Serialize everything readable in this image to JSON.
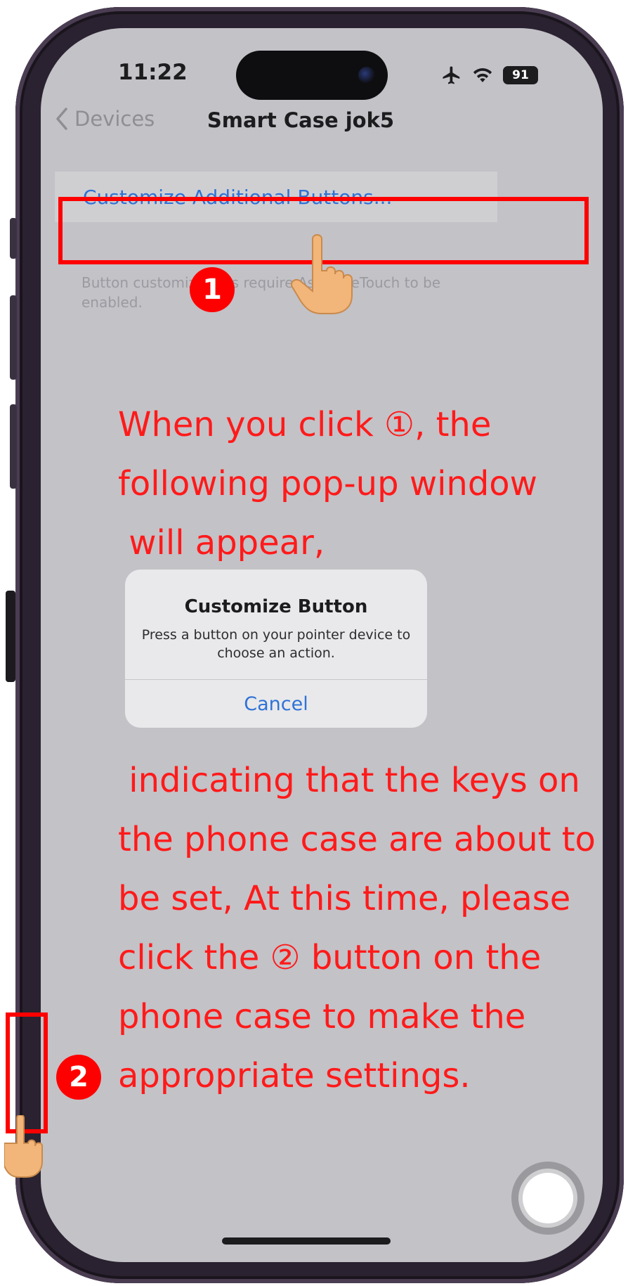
{
  "status_bar": {
    "time": "11:22",
    "battery": "91"
  },
  "nav": {
    "back_label": "Devices",
    "title": "Smart Case jok5"
  },
  "customize_row": {
    "label": "Customize Additional Buttons..."
  },
  "footnote": "Button customizations require AssistiveTouch to be enabled.",
  "annotation": {
    "badge_1": "1",
    "badge_2": "2",
    "text_top_line1": "When you click ①, the",
    "text_top_line2": "following pop-up window",
    "text_top_line3": " will appear,",
    "text_bottom_line1": " indicating that the keys on",
    "text_bottom_line2": "the phone case are about to",
    "text_bottom_line3": "be set, At this time, please",
    "text_bottom_line4": "click the ② button on the",
    "text_bottom_line5": "phone case to make the",
    "text_bottom_line6": "appropriate settings."
  },
  "alert": {
    "title": "Customize Button",
    "message": "Press a button on your pointer device to choose an action.",
    "cancel_label": "Cancel"
  },
  "colors": {
    "annotation_red": "#ff0000",
    "ios_blue": "#2f72d6",
    "screen_bg": "#c3c2c7"
  },
  "icons": [
    "chevron-left-icon",
    "airplane-icon",
    "wifi-icon",
    "battery-icon",
    "pointing-hand-icon",
    "assistive-touch-icon"
  ]
}
